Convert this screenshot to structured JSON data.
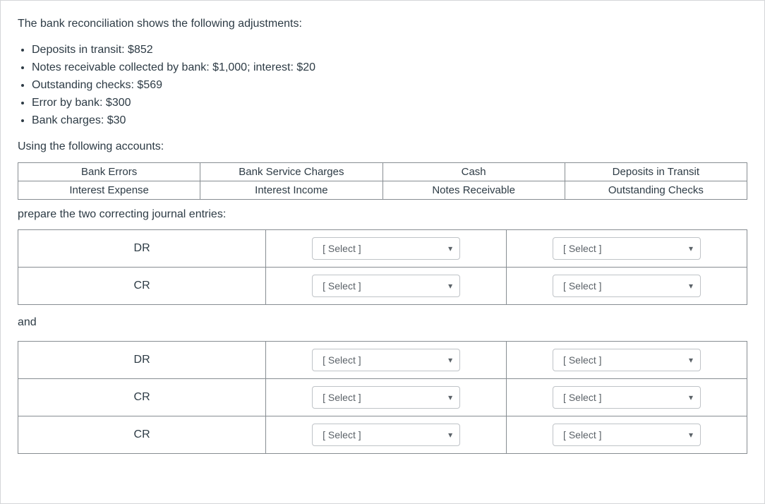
{
  "intro": "The bank reconciliation shows the following adjustments:",
  "bullets": [
    "Deposits in transit: $852",
    "Notes receivable collected by bank: $1,000; interest: $20",
    "Outstanding checks: $569",
    "Error by bank: $300",
    "Bank charges: $30"
  ],
  "using_accounts_label": "Using the following accounts:",
  "accounts": {
    "row1": [
      "Bank Errors",
      "Bank Service Charges",
      "Cash",
      "Deposits in Transit"
    ],
    "row2": [
      "Interest Expense",
      "Interest Income",
      "Notes Receivable",
      "Outstanding Checks"
    ]
  },
  "prepare_label": "prepare the two correcting journal entries:",
  "select_placeholder": "[ Select ]",
  "drcr_labels": {
    "dr": "DR",
    "cr": "CR"
  },
  "and_label": "and",
  "journal1": [
    {
      "side": "dr"
    },
    {
      "side": "cr"
    }
  ],
  "journal2": [
    {
      "side": "dr"
    },
    {
      "side": "cr"
    },
    {
      "side": "cr"
    }
  ]
}
